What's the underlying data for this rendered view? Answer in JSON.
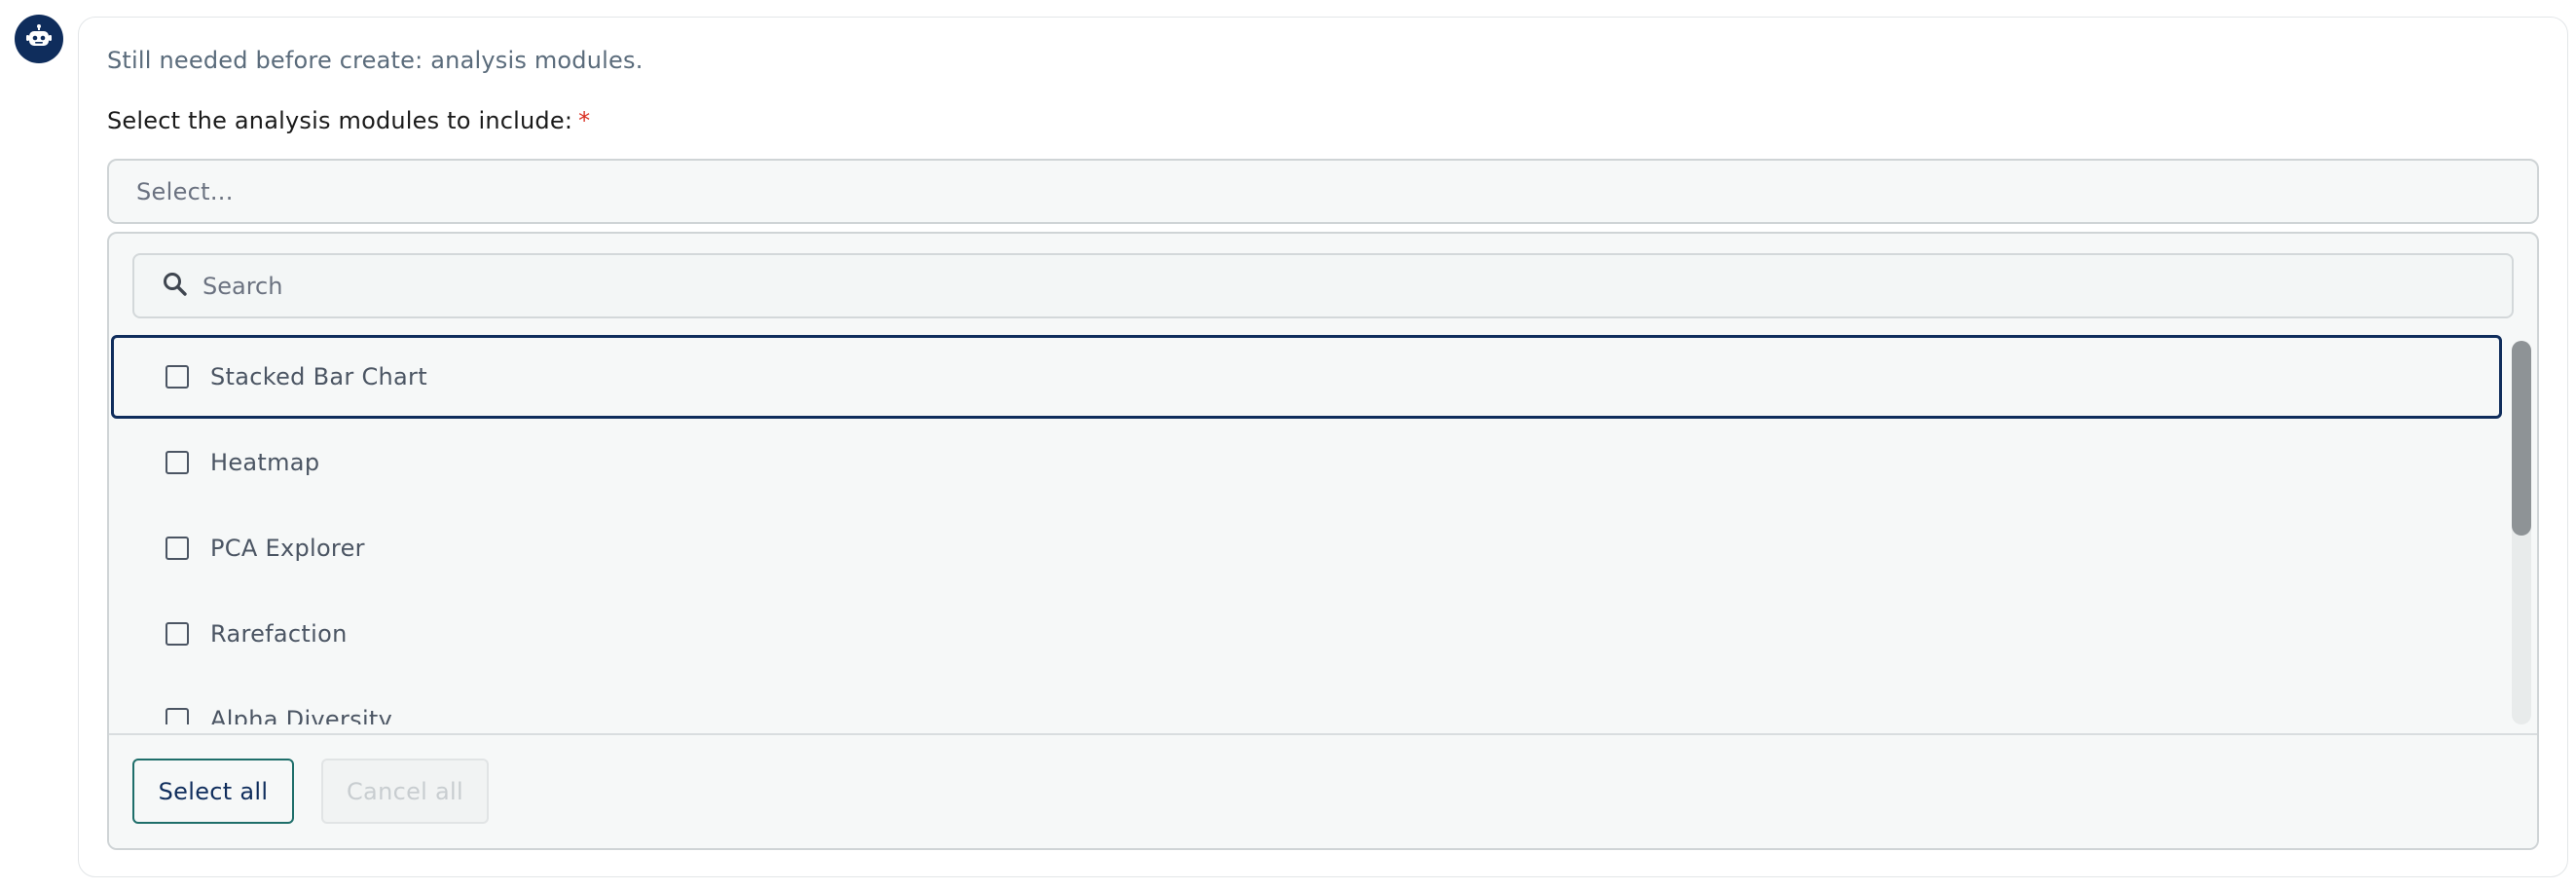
{
  "assistant": {
    "avatar_icon": "robot-icon",
    "accent": "#0f2d5c"
  },
  "message": {
    "status_text": "Still needed before create: analysis modules."
  },
  "field": {
    "label": "Select the analysis modules to include:",
    "required_marker": "*",
    "select_placeholder": "Select..."
  },
  "dropdown": {
    "search_placeholder": "Search",
    "options": [
      {
        "label": "Stacked Bar Chart",
        "checked": false,
        "focused": true
      },
      {
        "label": "Heatmap",
        "checked": false,
        "focused": false
      },
      {
        "label": "PCA Explorer",
        "checked": false,
        "focused": false
      },
      {
        "label": "Rarefaction",
        "checked": false,
        "focused": false
      },
      {
        "label": "Alpha Diversity",
        "checked": false,
        "focused": false
      }
    ],
    "select_all_label": "Select all",
    "cancel_all_label": "Cancel all"
  }
}
